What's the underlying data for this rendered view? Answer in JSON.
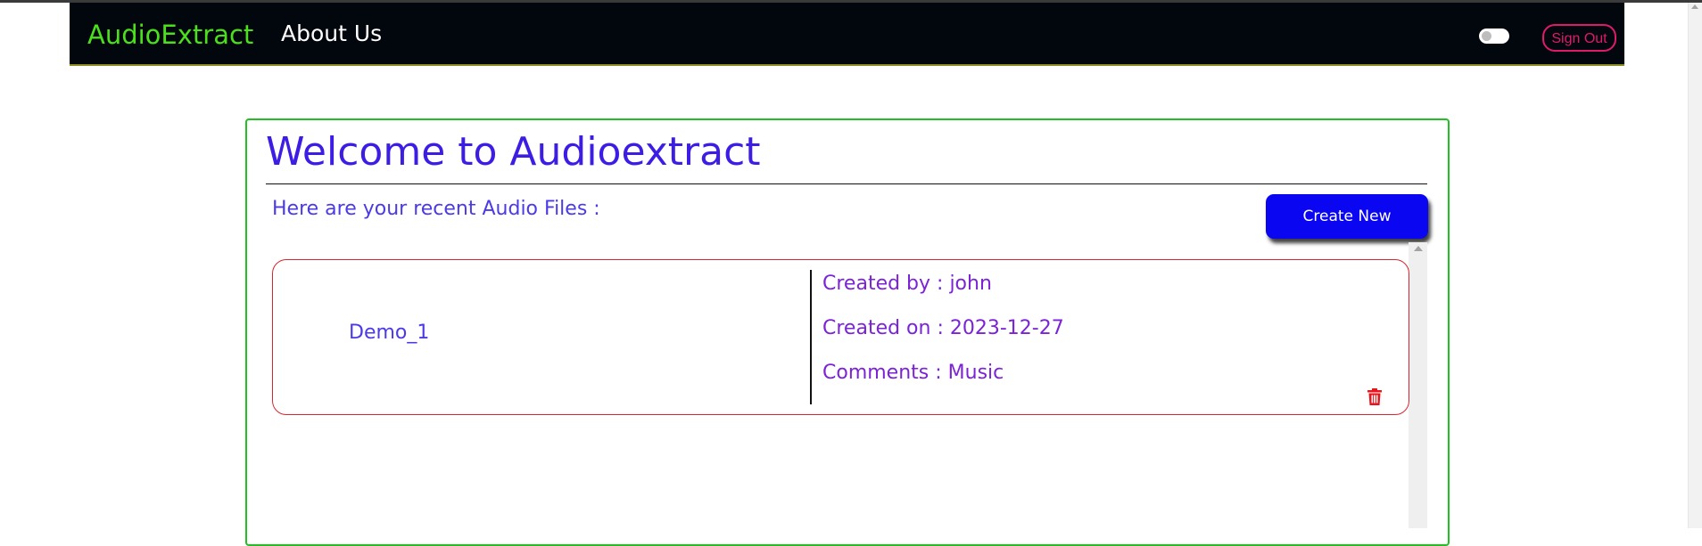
{
  "navbar": {
    "brand": "AudioExtract",
    "about_link": "About Us",
    "theme_toggle_icon": "toggle-switch-icon",
    "sign_out": "Sign Out"
  },
  "main": {
    "title": "Welcome to Audioextract",
    "subtitle": "Here are your recent Audio Files :",
    "create_button": "Create New"
  },
  "files": [
    {
      "name": "Demo_1",
      "created_by": "Created by : john",
      "created_on": "Created on : 2023-12-27",
      "comments": "Comments : Music",
      "delete_icon": "trash-icon"
    }
  ],
  "colors": {
    "navbar_bg": "#02070d",
    "brand": "#4ce01c",
    "accent_blue": "#0a06f2",
    "heading": "#3b1de6",
    "meta_text": "#7b23d6",
    "card_border": "#22c022",
    "file_border": "#d9262e",
    "sign_out": "#e0196a"
  }
}
